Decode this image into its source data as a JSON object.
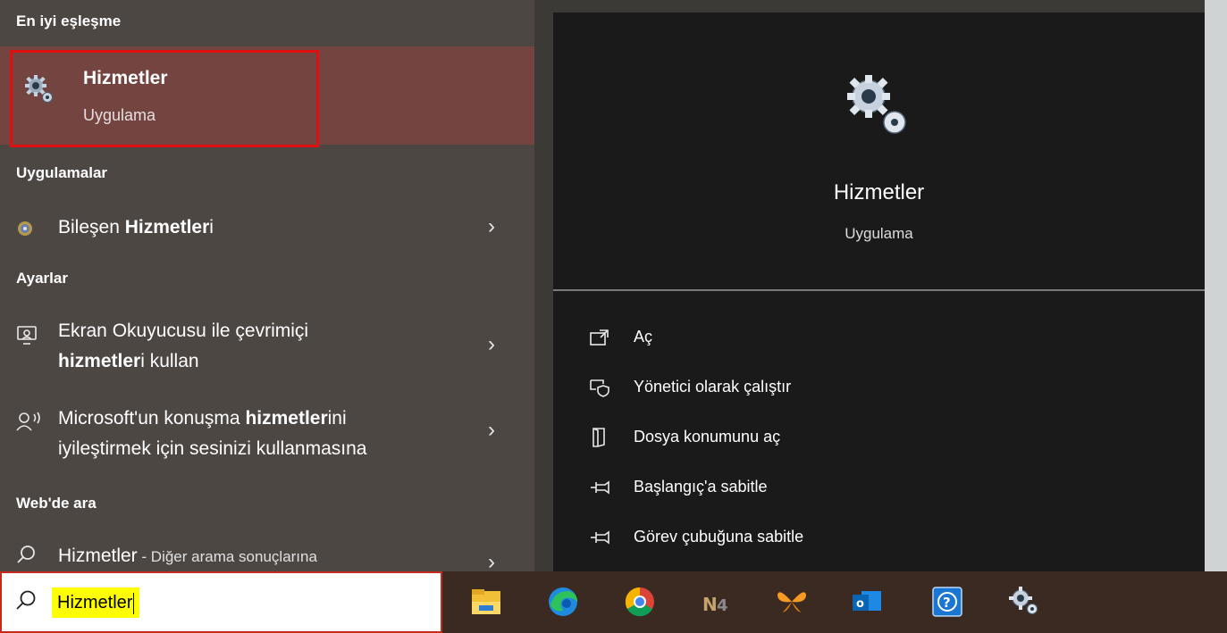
{
  "left": {
    "best_match_header": "En iyi eşleşme",
    "best_match": {
      "title": "Hizmetler",
      "subtitle": "Uygulama",
      "icon": "gears-icon"
    },
    "apps_header": "Uygulamalar",
    "apps": [
      {
        "pre": "Bileşen ",
        "bold": "Hizmetler",
        "post": "i",
        "icon": "component-services-icon"
      }
    ],
    "settings_header": "Ayarlar",
    "settings": [
      {
        "line1": "Ekran Okuyucusu ile çevrimiçi",
        "bold": "hizmetler",
        "line2_post": "i kullan",
        "icon": "narrator-icon"
      },
      {
        "line1_pre": "Microsoft'un konuşma ",
        "bold": "hizmetler",
        "line1_post": "ini",
        "line2": "iyileştirmek için sesinizi kullanmasına",
        "icon": "speech-icon"
      }
    ],
    "web_header": "Web'de ara",
    "web": {
      "query": "Hizmetler",
      "suffix": " - Diğer arama sonuçlarına",
      "icon": "search-icon"
    }
  },
  "preview": {
    "title": "Hizmetler",
    "subtitle": "Uygulama",
    "actions": [
      {
        "label": "Aç",
        "icon": "open-icon"
      },
      {
        "label": "Yönetici olarak çalıştır",
        "icon": "run-as-admin-icon"
      },
      {
        "label": "Dosya konumunu aç",
        "icon": "file-location-icon"
      },
      {
        "label": "Başlangıç'a sabitle",
        "icon": "pin-start-icon"
      },
      {
        "label": "Görev çubuğuna sabitle",
        "icon": "pin-taskbar-icon"
      }
    ]
  },
  "taskbar": {
    "search_value": "Hizmetler",
    "apps": [
      "file-explorer-icon",
      "edge-icon",
      "chrome-icon",
      "n4-icon",
      "butterfly-app-icon",
      "outlook-icon",
      "help-icon",
      "services-icon"
    ]
  },
  "colors": {
    "left_bg": "#4d4744",
    "best_match_bg": "#744540",
    "preview_bg": "#1a1a1a",
    "highlight_border": "#e01010",
    "search_highlight": "#ffff00"
  }
}
